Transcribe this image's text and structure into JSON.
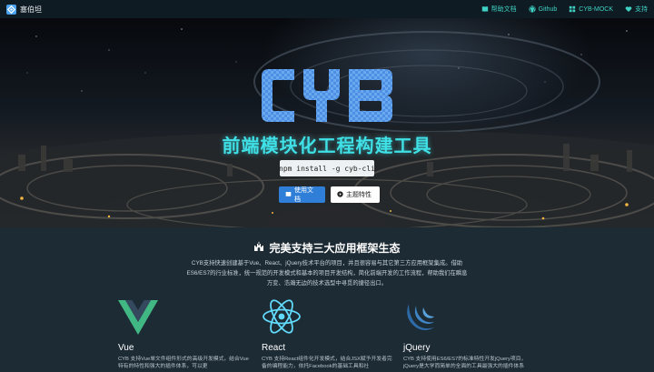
{
  "navbar": {
    "brand": "塞伯坦",
    "links": [
      {
        "label": "帮助文档",
        "icon": "book-icon"
      },
      {
        "label": "Github",
        "icon": "github-icon"
      },
      {
        "label": "CYB-MOCK",
        "icon": "grid-icon"
      },
      {
        "label": "支持",
        "icon": "heart-icon"
      }
    ]
  },
  "hero": {
    "logo": "CYB",
    "headline": "前端模块化工程构建工具",
    "command": "npm install -g cyb-cli",
    "primary_button": "使用文档",
    "secondary_button": "主题特性"
  },
  "features": {
    "title": "完美支持三大应用框架生态",
    "description": "CYB支持快速创建基于Vue、React、jQuery技术平台的项目，并且很容易与其它第三方应用框架集成。借助ES6/ES7的行业标准，统一规范的开发模式和基本的项目开发结构，简化前端开发的工作流程，帮助我们在瞬息万变、浩瀚无边的技术选型中寻觅的捷径出口。",
    "frameworks": [
      {
        "name": "Vue",
        "icon": "vue-logo-icon",
        "desc": "CYB 支持Vue单文件组件形式的高级开发模式，结合Vue特有的特性和强大的插件体系，可以更"
      },
      {
        "name": "React",
        "icon": "react-logo-icon",
        "desc": "CYB 支持React组件化开发模式，结合JSX赋予开发者完备的编程能力，依托Facebook的基础工具和社"
      },
      {
        "name": "jQuery",
        "icon": "jquery-logo-icon",
        "desc": "CYB 支持使用ES6/ES7的标准特性开发jQuery项目，jQuery是大学而简单的全面的工具最强大的插件体系"
      }
    ]
  },
  "colors": {
    "accent_cyan": "#3fe0e6",
    "primary_blue": "#2f7fd9",
    "vue_green": "#41b883",
    "vue_dark": "#34495e",
    "react_cyan": "#61dafb",
    "jquery_blue": "#2d6aa8"
  }
}
